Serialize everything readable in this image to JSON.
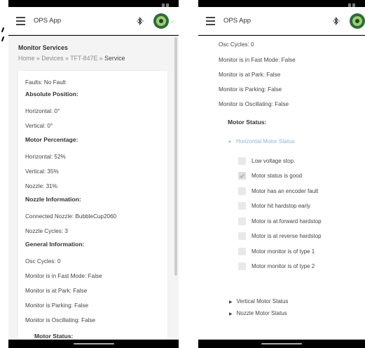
{
  "app": {
    "title": "OPS App"
  },
  "left": {
    "page_title": "Monitor Services",
    "breadcrumb": {
      "home": "Home",
      "sep": "»",
      "devices": "Devices",
      "device": "TFT-847E",
      "current": "Service"
    },
    "lines": {
      "faults": "Faults: No Fault",
      "abs_pos_head": "Absolute Position:",
      "abs_h": "Horizontal: 0°",
      "abs_v": "Vertical: 0°",
      "motor_pct_head": "Motor Percentage:",
      "pct_h": "Horizontal: 52%",
      "pct_v": "Vertical: 35%",
      "pct_n": "Nozzle: 31%",
      "nozzle_head": "Nozzle Information:",
      "nozzle_conn": "Connected Nozzle: BubbleCup2060",
      "nozzle_cycles": "Nozzle Cycles: 3",
      "general_head": "General Information:",
      "osc": "Osc Cycles: 0",
      "fast": "Monitor is in Fast Mode: False",
      "park": "Monitor is at Park: False",
      "parking": "Monitor is Parking: False",
      "oscillating": "Monitor is Oscillating: False",
      "motor_status_head": "Motor Status:"
    }
  },
  "right": {
    "lines": {
      "osc": "Osc Cycles: 0",
      "fast": "Monitor is in Fast Mode: False",
      "park": "Monitor is at Park: False",
      "parking": "Monitor is Parking: False",
      "oscillating": "Monitor is Oscillating: False"
    },
    "motor_status_head": "Motor Status:",
    "horizontal_section": "Horizontal Motor Status",
    "checkboxes": [
      {
        "label": "Low voltage stop.",
        "checked": false
      },
      {
        "label": "Motor status is good",
        "checked": true
      },
      {
        "label": "Motor has an encoder fault",
        "checked": false
      },
      {
        "label": "Motor hit hardstop early",
        "checked": false
      },
      {
        "label": "Motor is at forward hardstop",
        "checked": false
      },
      {
        "label": "Motor is at reverse hardstop",
        "checked": false
      },
      {
        "label": "Motor monitor is of type 1",
        "checked": false
      },
      {
        "label": "Motor monitor is of type 2",
        "checked": false
      }
    ],
    "vertical_section": "Vertical Motor Status",
    "nozzle_section": "Nozzle Motor Status"
  },
  "icons": {
    "menu": "hamburger-menu-icon",
    "bluetooth": "bluetooth-icon",
    "avatar": "device-avatar",
    "caret": "chevron-down-icon",
    "expanded": "triangle-down-icon",
    "collapsed": "triangle-right-icon",
    "check": "check-icon"
  },
  "colors": {
    "accent": "#8fb4d8",
    "header_bg": "#ffffff",
    "page_bg": "#f4f4f4",
    "checkbox": "#e9e9e9"
  }
}
